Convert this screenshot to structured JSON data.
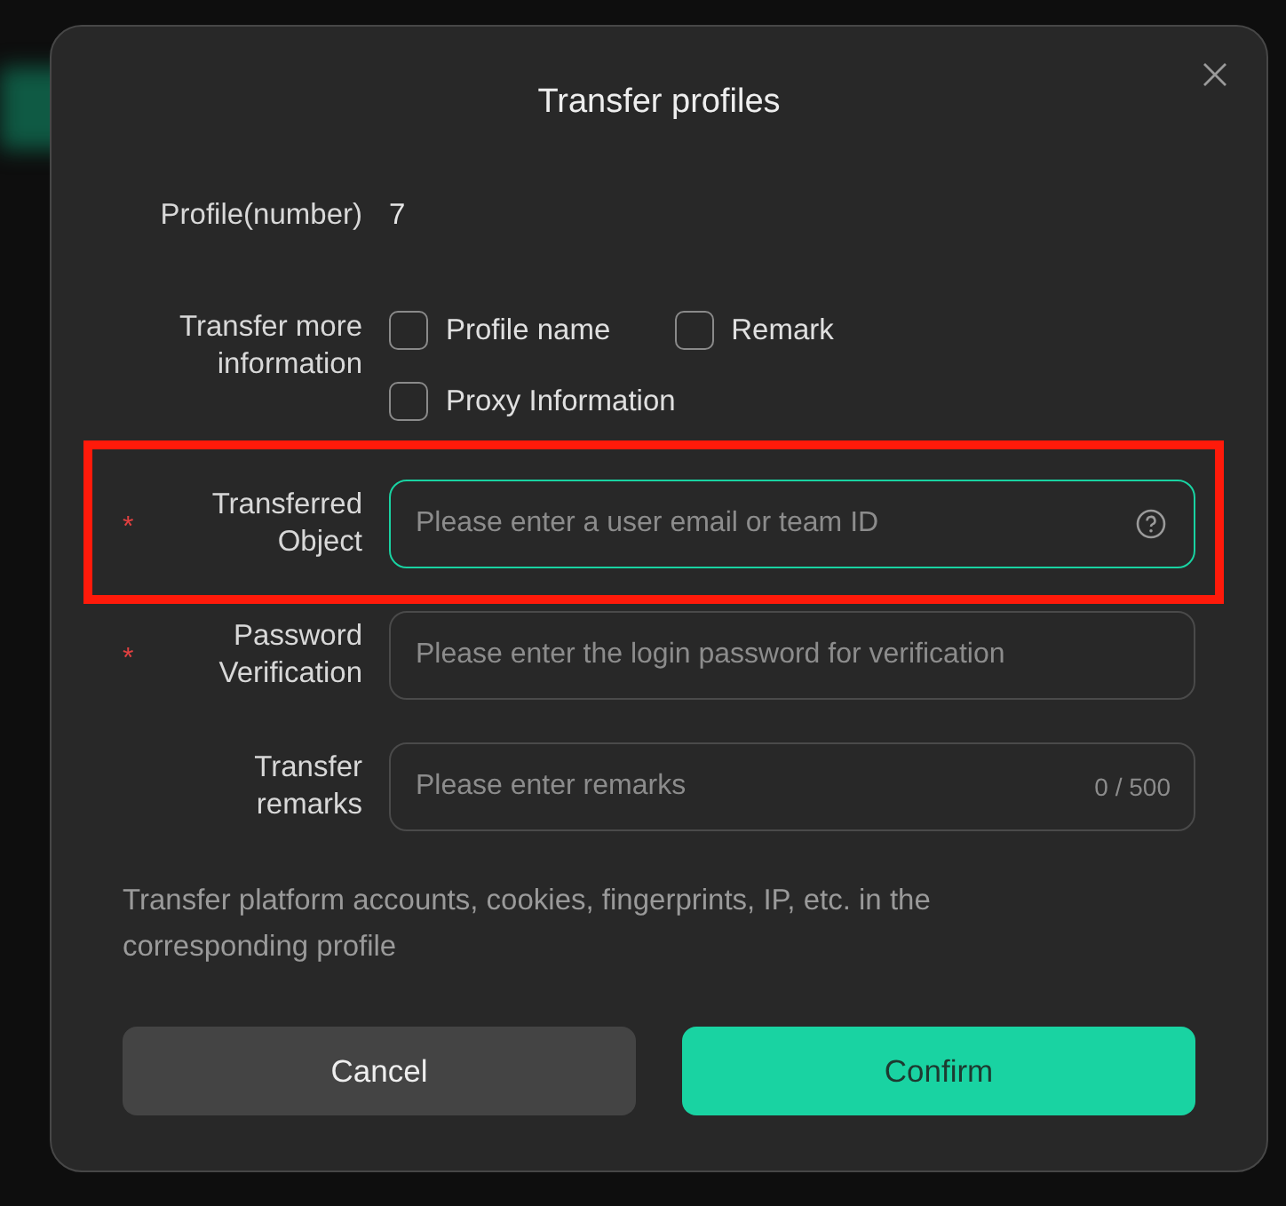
{
  "dialog": {
    "title": "Transfer profiles"
  },
  "profile_count": {
    "label": "Profile(number)",
    "value": "7"
  },
  "more_info": {
    "label": "Transfer more information",
    "options": [
      {
        "label": "Profile name",
        "checked": false
      },
      {
        "label": "Remark",
        "checked": false
      },
      {
        "label": "Proxy Information",
        "checked": false
      }
    ]
  },
  "fields": [
    {
      "label": "Transferred Object",
      "required_mark": "*",
      "placeholder": "Please enter a user email or team ID",
      "focused": true,
      "highlighted": true,
      "suffix": {
        "kind": "help"
      }
    },
    {
      "label": "Password Verification",
      "required_mark": "*",
      "placeholder": "Please enter the login password for verification",
      "focused": false
    },
    {
      "label": "Transfer remarks",
      "placeholder": "Please enter remarks",
      "focused": false,
      "suffix": {
        "kind": "counter",
        "text": "0 / 500"
      }
    }
  ],
  "description": "Transfer platform accounts, cookies, fingerprints, IP, etc. in the corresponding profile",
  "buttons": [
    {
      "label": "Cancel",
      "kind": "secondary"
    },
    {
      "label": "Confirm",
      "kind": "primary"
    }
  ]
}
